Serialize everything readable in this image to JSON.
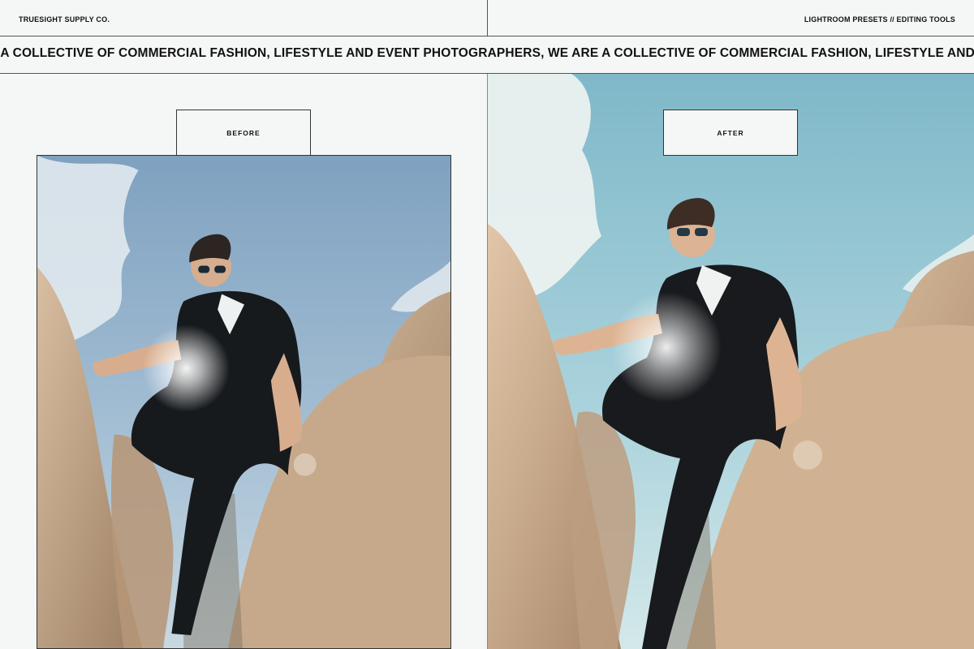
{
  "header": {
    "brand": "TRUESIGHT SUPPLY CO.",
    "tools": "LIGHTROOM PRESETS // EDITING TOOLS"
  },
  "marquee": {
    "text": "E A COLLECTIVE OF COMMERCIAL FASHION, LIFESTYLE AND EVENT PHOTOGRAPHERS, WE ARE A COLLECTIVE OF COMMERCIAL FASHION, LIFESTYLE AND EVENT PHOTOGRA"
  },
  "comparison": {
    "before_label": "BEFORE",
    "after_label": "AFTER"
  },
  "colors": {
    "background": "#f5f7f6",
    "before_sky": "#8fb1cb",
    "after_sky": "#92c3d1",
    "rock": "#c7ab8e"
  }
}
